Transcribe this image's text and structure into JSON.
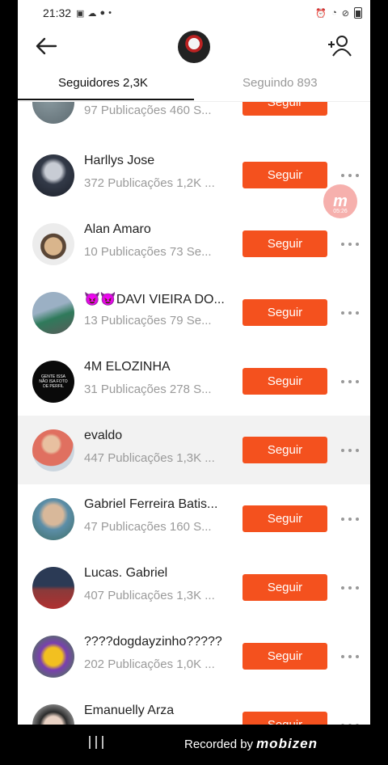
{
  "status_bar": {
    "time": "21:32",
    "icons": [
      "app-icon",
      "cloud-icon",
      "mobizen-icon",
      "dot-icon"
    ],
    "right_icons": [
      "alarm-icon",
      "wifi-icon",
      "dnd-icon",
      "battery-icon"
    ]
  },
  "header": {
    "back_icon": "arrow-left-icon",
    "add_icon": "add-user-icon"
  },
  "tabs": [
    {
      "label": "Seguidores 2,3K",
      "active": true
    },
    {
      "label": "Seguindo 893",
      "active": false
    }
  ],
  "follow_label": "Seguir",
  "users": [
    {
      "name": "",
      "stats": "97 Publicações   460 S..."
    },
    {
      "name": "Harllys Jose",
      "stats": "372 Publicações   1,2K ..."
    },
    {
      "name": "Alan Amaro",
      "stats": "10 Publicações   73 Se..."
    },
    {
      "name": "😈😈DAVI VIEIRA DO...",
      "stats": "13 Publicações   79 Se..."
    },
    {
      "name": "4M ELOZINHA",
      "stats": "31 Publicações   278 S..."
    },
    {
      "name": "evaldo",
      "stats": "447 Publicações   1,3K ..."
    },
    {
      "name": "Gabriel Ferreira Batis...",
      "stats": "47 Publicações   160 S..."
    },
    {
      "name": "Lucas.      Gabriel",
      "stats": "407 Publicações   1,3K ..."
    },
    {
      "name": "????dogdayzinho?????",
      "stats": "202 Publicações   1,0K ..."
    },
    {
      "name": "Emanuelly Arza",
      "stats": ""
    }
  ],
  "avatar_text_4": "GENTE ISSA NÃO ISA FOTO DE PERFIL",
  "float_badge": {
    "letter": "m",
    "time": "05:26"
  },
  "watermark": {
    "prefix": "Recorded by",
    "brand": "mobizen"
  },
  "colors": {
    "accent": "#f4511e",
    "highlight_row": "#f2f2f2"
  }
}
